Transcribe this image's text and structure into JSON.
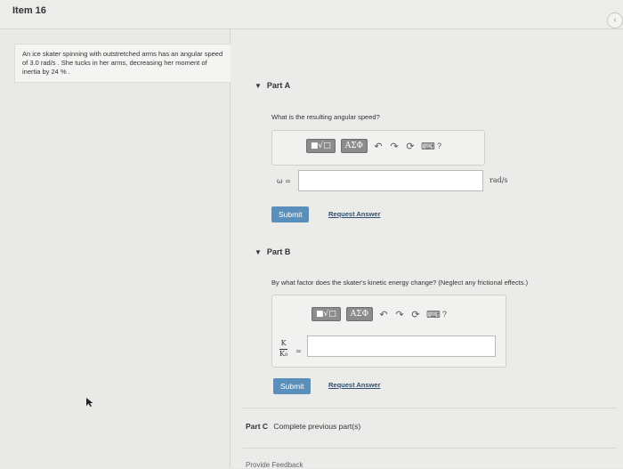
{
  "header": {
    "title": "Item 16"
  },
  "problem": {
    "text": "An ice skater spinning with outstretched arms has an angular speed of 3.0 rad/s . She tucks in her arms, decreasing her moment of inertia by 24 % ."
  },
  "part_a": {
    "label": "Part A",
    "question": "What is the resulting angular speed?",
    "toolbar": {
      "templates_label": "■√□",
      "greek_label": "ΑΣΦ",
      "help": "?"
    },
    "variable": "ω =",
    "unit": "rad/s",
    "answer_value": "",
    "submit": "Submit",
    "request": "Request Answer"
  },
  "part_b": {
    "label": "Part B",
    "question": "By what factor does the skater's kinetic energy change? (Neglect any frictional effects.)",
    "toolbar": {
      "templates_label": "■√□",
      "greek_label": "ΑΣΦ",
      "help": "?"
    },
    "frac_num": "K",
    "frac_den": "K₀",
    "equals": "=",
    "answer_value": "",
    "submit": "Submit",
    "request": "Request Answer"
  },
  "part_c": {
    "label": "Part C",
    "text": "Complete previous part(s)"
  },
  "feedback": "Provide Feedback"
}
